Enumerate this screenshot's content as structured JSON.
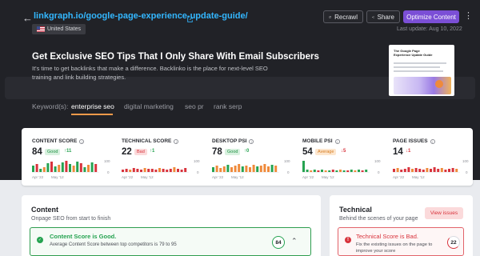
{
  "header": {
    "url": "linkgraph.io/google-page-experience-update-guide/",
    "recrawl_label": "Recrawl",
    "share_label": "Share",
    "optimize_label": "Optimize Content",
    "country": "United States",
    "last_update": "Last update: Aug 10, 2022"
  },
  "promo": {
    "title": "Get Exclusive SEO Tips That I Only Share With Email Subscribers",
    "description": "It's time to get backlinks that make a difference. Backlinko is the place for next-level SEO training and link building strategies.",
    "thumbnail_title": "The Google Page Experience Update Guide"
  },
  "keywords": {
    "label": "Keyword(s):",
    "tabs": [
      "enterprise seo",
      "digital marketing",
      "seo pr",
      "rank serp"
    ],
    "active_index": 0
  },
  "metrics": [
    {
      "label": "CONTENT SCORE",
      "value": "84",
      "badge": "Good",
      "badge_type": "good",
      "delta": "↑11",
      "delta_dir": "up",
      "axis_max": "100",
      "axis_min": "0",
      "date_start": "Apr '22",
      "date_end": "May '12",
      "bar_color": "green"
    },
    {
      "label": "TECHNICAL SCORE",
      "value": "22",
      "badge": "Bad",
      "badge_type": "bad",
      "delta": "↑1",
      "delta_dir": "up",
      "axis_max": "100",
      "axis_min": "0",
      "date_start": "Apr '22",
      "date_end": "May '12",
      "bar_color": "red"
    },
    {
      "label": "DESKTOP PSI",
      "value": "78",
      "badge": "Good",
      "badge_type": "good",
      "delta": "↑0",
      "delta_dir": "up",
      "axis_max": "100",
      "axis_min": "0",
      "date_start": "Apr '22",
      "date_end": "May '12",
      "bar_color": "orange"
    },
    {
      "label": "MOBILE PSI",
      "value": "54",
      "badge": "Average",
      "badge_type": "avg",
      "delta": "↓5",
      "delta_dir": "down",
      "axis_max": "100",
      "axis_min": "0",
      "date_start": "Apr '22",
      "date_end": "May '12",
      "bar_color": "green"
    },
    {
      "label": "PAGE ISSUES",
      "value": "14",
      "badge": "",
      "badge_type": "",
      "delta": "↓1",
      "delta_dir": "down",
      "axis_max": "100",
      "axis_min": "0",
      "date_start": "Apr '22",
      "date_end": "May '12",
      "bar_color": "red"
    }
  ],
  "content_card": {
    "title": "Content",
    "subtitle": "Onpage SEO from start to finish",
    "status_title": "Content Score is Good.",
    "status_text": "Average Content Score between top competitors is 79 to 95",
    "score": "84"
  },
  "technical_card": {
    "title": "Technical",
    "subtitle": "Behind the scenes of your page",
    "view_issues_label": "View issues",
    "status_title": "Technical Score is Bad.",
    "status_text": "Fix the existing issues on the page to improve your score",
    "score": "22"
  },
  "colors": {
    "accent": "#7b4fd6",
    "link": "#33b7ff",
    "good": "#26a351",
    "bad": "#d8333c",
    "average": "#ef8a3b",
    "underline": "#f39a4a"
  }
}
